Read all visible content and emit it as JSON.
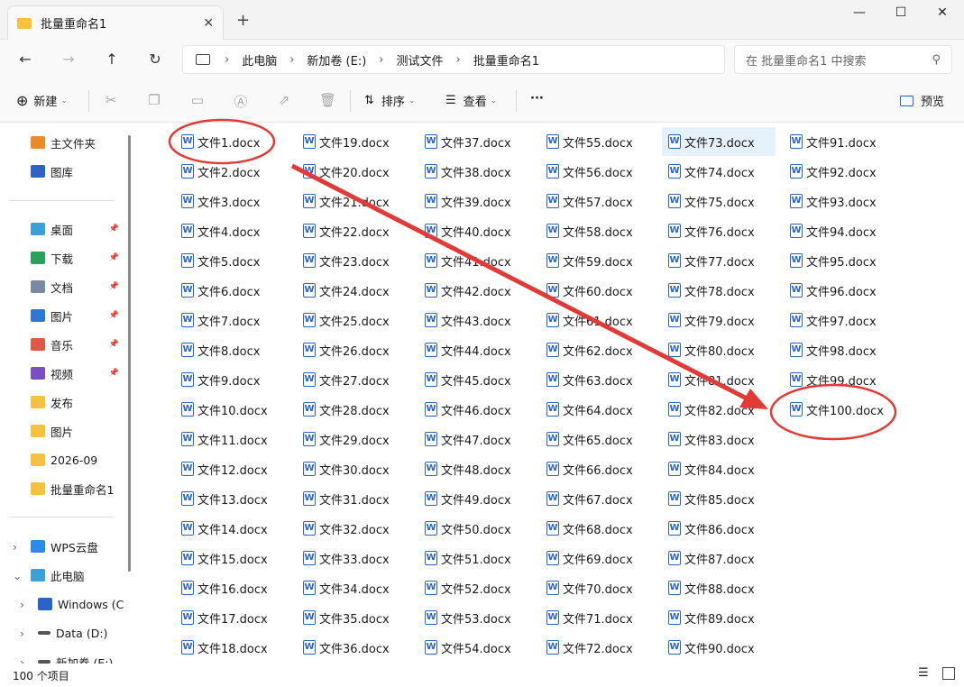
{
  "window": {
    "tab_title": "批量重命名1",
    "tab_close": "✕",
    "new_tab": "+",
    "minimize": "—",
    "maximize": "☐",
    "close": "✕"
  },
  "nav": {
    "back": "←",
    "forward": "→",
    "up": "↑",
    "refresh": "↻",
    "breadcrumbs": [
      "此电脑",
      "新加卷 (E:)",
      "测试文件",
      "批量重命名1"
    ],
    "search_placeholder": "在 批量重命名1 中搜索"
  },
  "toolbar": {
    "new_label": "新建",
    "sort_label": "排序",
    "view_label": "查看",
    "more_label": "···",
    "preview_label": "预览"
  },
  "sidebar": {
    "items": [
      {
        "label": "主文件夹",
        "icon": "home-icon"
      },
      {
        "label": "图库",
        "icon": "gallery-icon"
      },
      {
        "label": "桌面",
        "icon": "desktop-icon",
        "pinned": true
      },
      {
        "label": "下载",
        "icon": "download-icon",
        "pinned": true
      },
      {
        "label": "文档",
        "icon": "document-icon",
        "pinned": true
      },
      {
        "label": "图片",
        "icon": "pictures-icon",
        "pinned": true
      },
      {
        "label": "音乐",
        "icon": "music-icon",
        "pinned": true
      },
      {
        "label": "视频",
        "icon": "video-icon",
        "pinned": true
      },
      {
        "label": "发布",
        "icon": "folder-icon"
      },
      {
        "label": "图片",
        "icon": "folder-icon"
      },
      {
        "label": "2026-09",
        "icon": "folder-icon"
      },
      {
        "label": "批量重命名1",
        "icon": "folder-icon"
      },
      {
        "label": "WPS云盘",
        "icon": "cloud-icon"
      },
      {
        "label": "此电脑",
        "icon": "pc-icon"
      },
      {
        "label": "Windows (C",
        "icon": "drive-c-icon"
      },
      {
        "label": "Data (D:)",
        "icon": "drive-icon"
      },
      {
        "label": "新加卷 (E:)",
        "icon": "drive-icon"
      }
    ]
  },
  "files": {
    "name_prefix": "文件",
    "extension": ".docx",
    "first_number": 1,
    "last_number": 100,
    "rows_per_column": 18,
    "selected": "文件73.docx",
    "icon_letter": "W"
  },
  "status": {
    "item_count": "100 个项目"
  },
  "annotation": {
    "color": "#e23a36",
    "circled_first": "文件1.docx",
    "circled_last": "文件100.docx"
  }
}
